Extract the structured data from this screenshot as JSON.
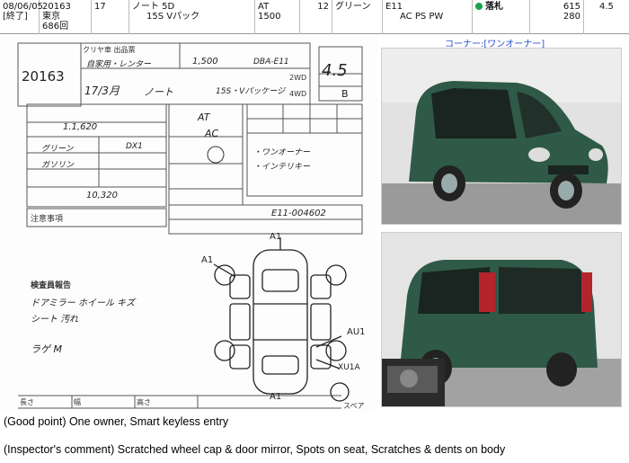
{
  "header": {
    "date": "08/06/05",
    "status": "[終了]",
    "lot": "20163",
    "venue": "東京",
    "session": "686回",
    "year": "17",
    "model": "ノート 5D",
    "grade": "15S Vパック",
    "transmission": "AT",
    "displacement": "1500",
    "mileage": "12",
    "color": "グリーン",
    "chassis": "E11",
    "options": "AC PS PW",
    "result": "落札",
    "price": "615",
    "start": "280",
    "score": "4.5"
  },
  "corner_label": "コーナー:[ワンオーナー]",
  "sheet": {
    "lot_no": "20163",
    "title": "クリヤ車 出品票",
    "score": "4.5",
    "interior": "B",
    "seller": "自家用・レンター",
    "year_label": "17/3月",
    "model_name": "ノート",
    "grade_label": "15S・Vパッケージ",
    "displacement": "1,500",
    "engine_code": "DBA-E11",
    "mileage": "1.1,620",
    "shift": "AT",
    "ac": "AC",
    "colors": "グリーン",
    "color_code": "DX1",
    "fuel": "ガソリン",
    "recycle": "10,320",
    "chassis_no": "E11-004602",
    "notes": "注意事項",
    "inspector_title": "検査員報告",
    "inspector_notes": [
      "ドアミラー ホイール キズ",
      "シート 汚れ",
      "ラゲ M"
    ],
    "damage_marks": [
      "A1",
      "A1",
      "AU1",
      "XU1A",
      "A1"
    ],
    "sales_points": [
      "・ワンオーナー",
      "・インテリキー"
    ],
    "drive_options": [
      "2WD",
      "4WD"
    ],
    "length_label": "長さ",
    "width_label": "幅",
    "height_label": "高さ",
    "spare_label": "スペア"
  },
  "captions": {
    "good_point": "(Good point) One owner, Smart keyless entry",
    "inspector": "(Inspector's comment) Scratched wheel cap & door mirror, Spots on seat, Scratches & dents on body"
  },
  "colors": {
    "car_body": "#2f5a48",
    "accent": "#17a34a",
    "link": "#2a4fd0"
  }
}
